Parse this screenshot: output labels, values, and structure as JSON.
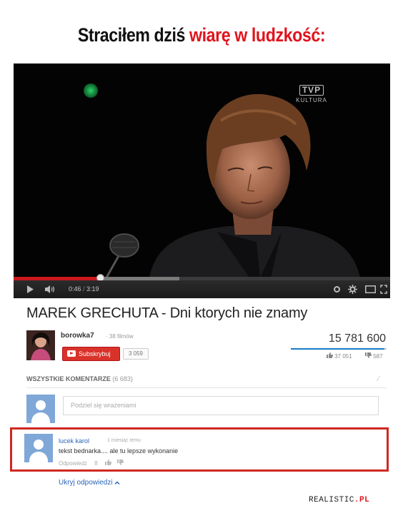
{
  "meme": {
    "title_black": "Straciłem dziś ",
    "title_red": "wiarę w ludzkość:"
  },
  "video": {
    "channel_logo_main": "TVP",
    "channel_logo_sub": "KULTURA",
    "time_current": "0:46",
    "time_total": "3:19",
    "progress_fraction": 0.23,
    "buffer_fraction": 0.44,
    "icons": [
      "play-icon",
      "volume-icon",
      "settings-icon",
      "gear-icon",
      "theater-icon",
      "fullscreen-icon"
    ]
  },
  "info": {
    "title": "MAREK GRECHUTA - Dni ktorych nie znamy",
    "channel_name": "borowka7",
    "video_count": "· 38 filmów",
    "subscribe_label": "Subskrybuj",
    "subscriber_count": "3 059",
    "views": "15 781 600",
    "likes": "37 051",
    "dislikes": "587",
    "like_ratio": 0.98
  },
  "comments": {
    "header": "WSZYSTKIE KOMENTARZE",
    "count": "(6 683)",
    "share_placeholder": "Podziel się wrażeniami",
    "comment": {
      "author": "lucek karol",
      "time": "1 miesiąc temu",
      "text": "tekst bednarka.... ale tu lepsze wykonanie",
      "reply_label": "Odpowiedz",
      "like_count": "8"
    },
    "hide_replies": "Ukryj odpowiedzi"
  },
  "watermark": {
    "part1": "REALISTIC",
    "part2": ".PL"
  },
  "colors": {
    "accent_red": "#e0141c",
    "link_blue": "#2a66b8",
    "avatar_blue": "#7fa7d8"
  }
}
